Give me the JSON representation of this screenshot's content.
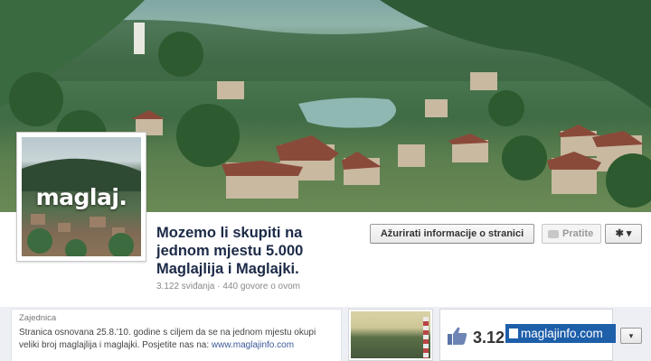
{
  "cover": {
    "description_icon": "town-landscape-photo"
  },
  "profile": {
    "logo_text": "maglaj."
  },
  "page": {
    "title": "Mozemo li skupiti na jednom mjestu 5.000 Maglajlija i Maglajki.",
    "stats": "3.122 sviđanja · 440 govore o ovom"
  },
  "actions": {
    "update_label": "Ažurirati informacije o stranici",
    "follow_label": "Pratite",
    "gear_label": "✱ ▾"
  },
  "about": {
    "category": "Zajednica",
    "text": "Stranica osnovana 25.8.'10. godine s ciljem da se na jednom mjestu okupi veliki broj maglajlija i maglajki. Posjetite nas na:",
    "link": "www.maglajinfo.com"
  },
  "likes": {
    "count": "3.12"
  },
  "watermark": {
    "text": "maglajinfo.com"
  },
  "dropdown": {
    "label": "▾"
  },
  "colors": {
    "title": "#1c2a47",
    "link": "#3b5998",
    "watermark_bg": "#1e5faa"
  }
}
